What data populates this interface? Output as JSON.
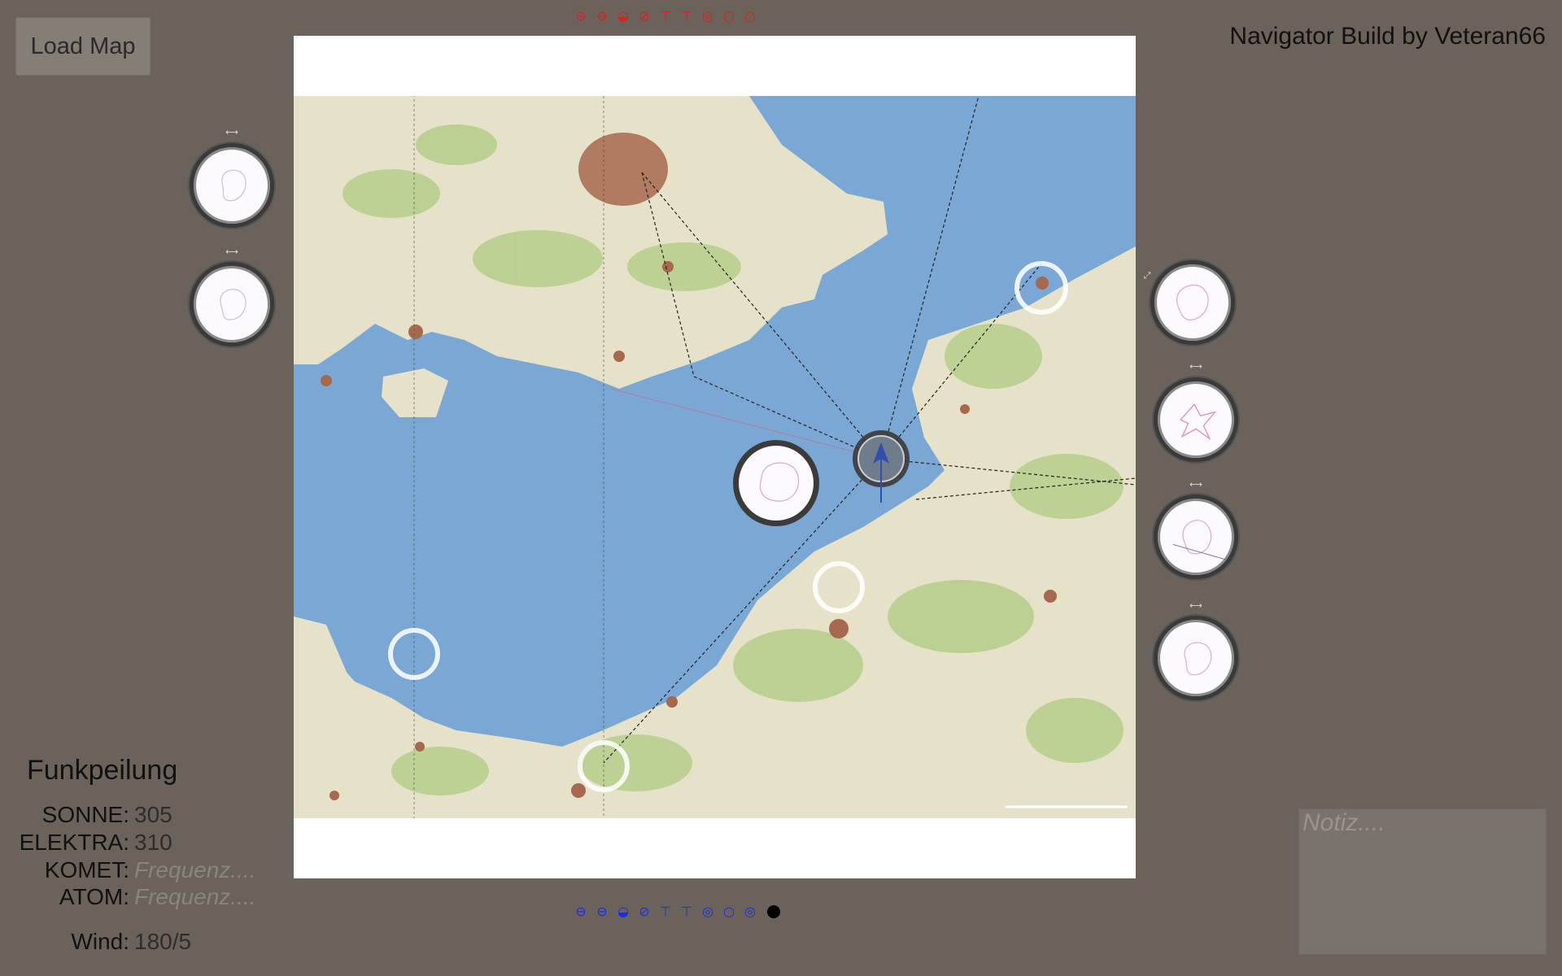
{
  "header": {
    "load_map_label": "Load Map",
    "app_title": "Navigator Build by Veteran66"
  },
  "toolbar_red": {
    "color": "#e0201a",
    "tools": [
      {
        "icon": "circle-minus-icon",
        "glyph": "⊖"
      },
      {
        "icon": "circle-minus-icon",
        "glyph": "⊖"
      },
      {
        "icon": "dome-icon",
        "glyph": "◒"
      },
      {
        "icon": "circle-slash-icon",
        "glyph": "⊘"
      },
      {
        "icon": "plane-down-icon",
        "glyph": "⊤"
      },
      {
        "icon": "plane-top-icon",
        "glyph": "⊤"
      },
      {
        "icon": "target-icon",
        "glyph": "◎"
      },
      {
        "icon": "ring-icon",
        "glyph": "○"
      },
      {
        "icon": "ring-icon",
        "glyph": "○"
      }
    ]
  },
  "toolbar_blue": {
    "color": "#1a2ee8",
    "tools": [
      {
        "icon": "circle-minus-icon",
        "glyph": "⊖"
      },
      {
        "icon": "circle-minus-icon",
        "glyph": "⊖"
      },
      {
        "icon": "dome-icon",
        "glyph": "◒"
      },
      {
        "icon": "circle-slash-icon",
        "glyph": "⊘"
      },
      {
        "icon": "plane-down-icon",
        "glyph": "⊤"
      },
      {
        "icon": "plane-top-icon",
        "glyph": "⊤"
      },
      {
        "icon": "target-icon",
        "glyph": "◎"
      },
      {
        "icon": "ring-icon",
        "glyph": "○"
      },
      {
        "icon": "target-icon",
        "glyph": "◎"
      }
    ]
  },
  "funkpeilung": {
    "title": "Funkpeilung",
    "stations": [
      {
        "label": "SONNE:",
        "value": "305"
      },
      {
        "label": "ELEKTRA:",
        "value": "310"
      },
      {
        "label": "KOMET:",
        "placeholder": "Frequenz...."
      },
      {
        "label": "ATOM:",
        "placeholder": "Frequenz...."
      }
    ],
    "wind_label": "Wind:",
    "wind_value": "180/5"
  },
  "notes": {
    "placeholder": "Notiz...."
  },
  "colors": {
    "background": "#6b625b",
    "sea": "#7aa7d3",
    "land": "#e6e2c9",
    "forest": "#b7cf8d",
    "urban": "#a6694d"
  }
}
